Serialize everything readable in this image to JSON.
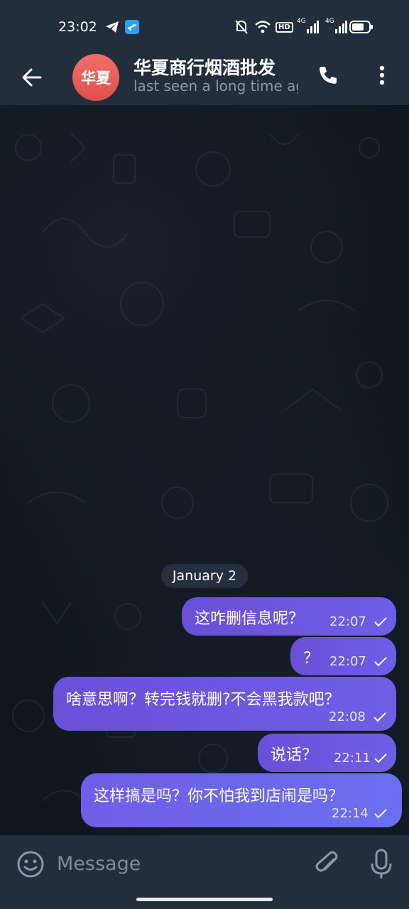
{
  "status_bar": {
    "time": "23:02",
    "network_label": "HD",
    "signal1_label": "4G",
    "signal2_label": "4G"
  },
  "header": {
    "avatar_text": "华夏",
    "title": "华夏商行烟酒批发",
    "status": "last seen a long time ago"
  },
  "chat": {
    "date_label": "January 2",
    "messages": [
      {
        "text": "这咋删信息呢？",
        "time": "22:07"
      },
      {
        "text": "？",
        "time": "22:07"
      },
      {
        "text": "啥意思啊？转完钱就删?不会黑我款吧？",
        "time": "22:08"
      },
      {
        "text": "说话？",
        "time": "22:11"
      },
      {
        "text": "这样搞是吗？你不怕我到店闹是吗？",
        "time": "22:14"
      }
    ]
  },
  "composer": {
    "placeholder": "Message"
  },
  "colors": {
    "bubble": "#6a4fd8",
    "header": "#232e3c",
    "avatar": "#e8605a",
    "background": "#0e141c"
  },
  "icons": [
    "arrow-left-icon",
    "phone-icon",
    "more-vert-icon",
    "emoji-icon",
    "paperclip-icon",
    "microphone-icon",
    "telegram-icon",
    "plane-icon",
    "bell-off-icon",
    "wifi-icon",
    "battery-icon"
  ]
}
